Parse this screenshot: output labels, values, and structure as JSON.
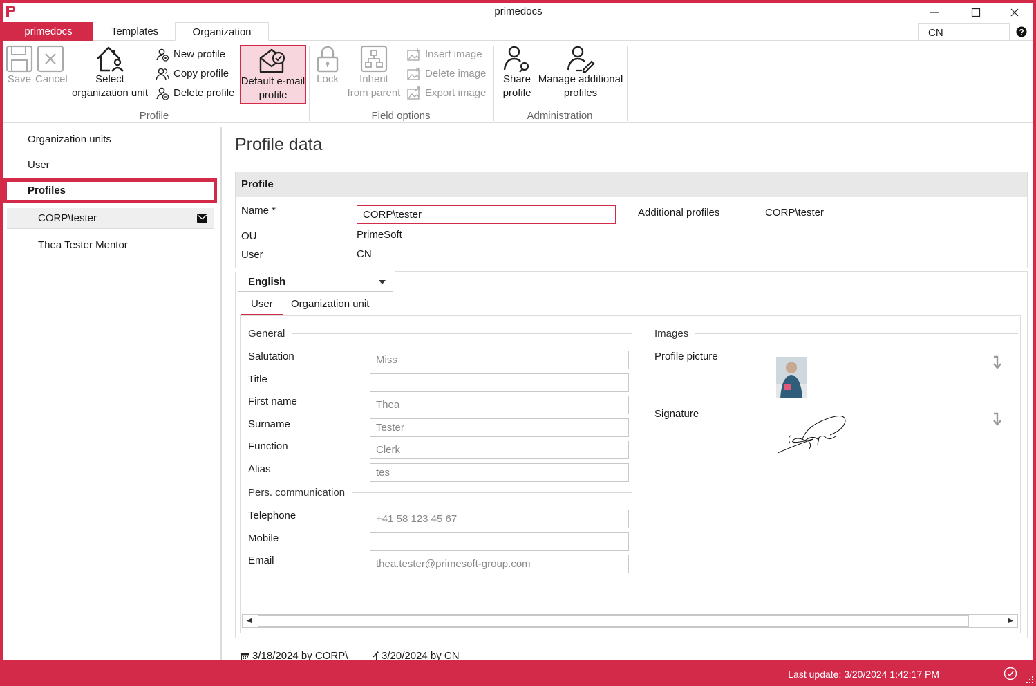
{
  "window": {
    "title": "primedocs"
  },
  "ribbon_tabs": [
    "primedocs",
    "Templates",
    "Organization"
  ],
  "user_box": "CN",
  "ribbon": {
    "save": "Save",
    "cancel": "Cancel",
    "select_ou_1": "Select",
    "select_ou_2": "organization unit",
    "new_profile": "New profile",
    "copy_profile": "Copy profile",
    "delete_profile": "Delete profile",
    "default_email_1": "Default e-mail",
    "default_email_2": "profile",
    "group_profile": "Profile",
    "lock": "Lock",
    "inherit_1": "Inherit",
    "inherit_2": "from parent",
    "insert_image": "Insert image",
    "delete_image": "Delete image",
    "export_image": "Export image",
    "group_field_options": "Field options",
    "share_1": "Share",
    "share_2": "profile",
    "manage_1": "Manage additional",
    "manage_2": "profiles",
    "group_administration": "Administration"
  },
  "sidebar": {
    "items": [
      "Organization units",
      "User",
      "Profiles"
    ],
    "profiles": [
      "CORP\\tester",
      "Thea Tester Mentor"
    ]
  },
  "content": {
    "title": "Profile data",
    "panel_head": "Profile",
    "name_label": "Name *",
    "name_value": "CORP\\tester",
    "ou_label": "OU",
    "ou_value": "PrimeSoft",
    "user_label": "User",
    "user_value": "CN",
    "additional_label": "Additional profiles",
    "additional_value": "CORP\\tester",
    "language": "English",
    "subtabs": [
      "User",
      "Organization unit"
    ]
  },
  "general": {
    "title": "General",
    "fields": [
      {
        "label": "Salutation",
        "value": "Miss"
      },
      {
        "label": "Title",
        "value": ""
      },
      {
        "label": "First name",
        "value": "Thea"
      },
      {
        "label": "Surname",
        "value": "Tester"
      },
      {
        "label": "Function",
        "value": "Clerk"
      },
      {
        "label": "Alias",
        "value": "tes"
      }
    ]
  },
  "communication": {
    "title": "Pers. communication",
    "fields": [
      {
        "label": "Telephone",
        "value": "+41 58 123 45 67"
      },
      {
        "label": "Mobile",
        "value": ""
      },
      {
        "label": "Email",
        "value": "thea.tester@primesoft-group.com"
      }
    ]
  },
  "images": {
    "title": "Images",
    "profile_picture": "Profile picture",
    "signature": "Signature"
  },
  "footer": {
    "created": "3/18/2024 by CORP\\",
    "modified": "3/20/2024 by CN"
  },
  "status": {
    "last_update": "Last update: 3/20/2024 1:42:17 PM"
  },
  "colors": {
    "brand": "#d42a4a",
    "highlight": "#f8d6dd"
  }
}
